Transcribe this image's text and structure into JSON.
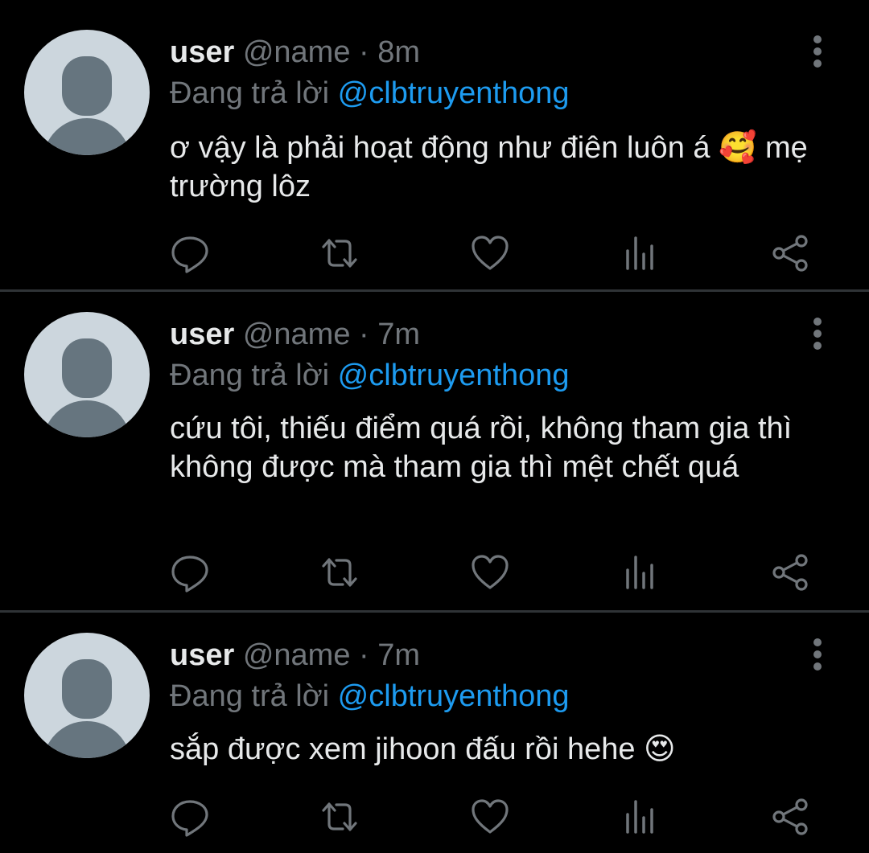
{
  "colors": {
    "background": "#000000",
    "text": "#e7e9ea",
    "secondary": "#71767b",
    "mention": "#1d9bf0",
    "divider": "#2f3336",
    "avatar_bg": "#ccd6dd",
    "avatar_fg": "#66757f"
  },
  "tweets": [
    {
      "display_name": "user",
      "handle": "@name",
      "separator": "·",
      "time": "8m",
      "reply_prefix": "Đang trả lời",
      "reply_to": "@clbtruyenthong",
      "text": "ơ vậy là phải hoạt động như điên luôn á 🥰 mẹ trường lôz",
      "icons": [
        "reply-icon",
        "retweet-icon",
        "like-icon",
        "analytics-icon",
        "share-icon"
      ]
    },
    {
      "display_name": "user",
      "handle": "@name",
      "separator": "·",
      "time": "7m",
      "reply_prefix": "Đang trả lời",
      "reply_to": "@clbtruyenthong",
      "text": "cứu tôi, thiếu điểm quá rồi, không tham gia thì không được mà tham gia thì mệt chết quá",
      "icons": [
        "reply-icon",
        "retweet-icon",
        "like-icon",
        "analytics-icon",
        "share-icon"
      ]
    },
    {
      "display_name": "user",
      "handle": "@name",
      "separator": "·",
      "time": "7m",
      "reply_prefix": "Đang trả lời",
      "reply_to": "@clbtruyenthong",
      "text": "sắp được xem jihoon đấu rồi hehe 😍",
      "icons": [
        "reply-icon",
        "retweet-icon",
        "like-icon",
        "analytics-icon",
        "share-icon"
      ]
    }
  ]
}
